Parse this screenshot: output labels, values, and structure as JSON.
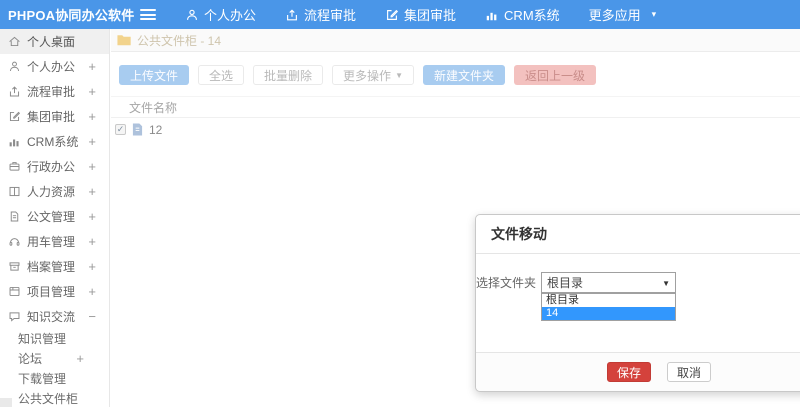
{
  "navbar": {
    "logo": "PHPOA协同办公软件",
    "items": [
      {
        "icon": "user-icon",
        "label": "个人办公"
      },
      {
        "icon": "upload-icon",
        "label": "流程审批"
      },
      {
        "icon": "edit-icon",
        "label": "集团审批"
      },
      {
        "icon": "chart-icon",
        "label": "CRM系统"
      },
      {
        "icon": "caret-down-icon",
        "label": "更多应用"
      }
    ],
    "caret": "▾"
  },
  "sidebar": {
    "items": [
      {
        "icon": "home-icon",
        "label": "个人桌面",
        "expand": "",
        "active": true
      },
      {
        "icon": "user-icon",
        "label": "个人办公",
        "expand": "+"
      },
      {
        "icon": "upload-icon",
        "label": "流程审批",
        "expand": "+"
      },
      {
        "icon": "edit-icon",
        "label": "集团审批",
        "expand": "+"
      },
      {
        "icon": "chart-icon",
        "label": "CRM系统",
        "expand": "+"
      },
      {
        "icon": "briefcase-icon",
        "label": "行政办公",
        "expand": "+"
      },
      {
        "icon": "book-icon",
        "label": "人力资源",
        "expand": "+"
      },
      {
        "icon": "document-icon",
        "label": "公文管理",
        "expand": "+"
      },
      {
        "icon": "headset-icon",
        "label": "用车管理",
        "expand": "+"
      },
      {
        "icon": "archive-icon",
        "label": "档案管理",
        "expand": "+"
      },
      {
        "icon": "project-icon",
        "label": "项目管理",
        "expand": "+"
      },
      {
        "icon": "chat-icon",
        "label": "知识交流",
        "expand": "−"
      }
    ],
    "subitems": [
      {
        "label": "知识管理",
        "expand": ""
      },
      {
        "label": "论坛",
        "expand": "+"
      },
      {
        "label": "下载管理",
        "expand": ""
      },
      {
        "label": "公共文件柜",
        "expand": ""
      }
    ]
  },
  "breadcrumb": {
    "icon": "folder-icon",
    "text": "公共文件柜 - 14"
  },
  "toolbar": {
    "upload_label": "上传文件",
    "select_all_label": "全选",
    "batch_delete_label": "批量删除",
    "more_actions_label": "更多操作",
    "more_actions_caret": "▼",
    "new_folder_label": "新建文件夹",
    "go_back_label": "返回上一级"
  },
  "table": {
    "header": "文件名称",
    "rows": [
      {
        "name": "12",
        "checked": true
      }
    ],
    "check_glyph": "✓"
  },
  "modal": {
    "title": "文件移动",
    "field_label": "选择文件夹",
    "select_value": "根目录",
    "select_caret": "▼",
    "options": [
      {
        "label": "根目录",
        "selected": false
      },
      {
        "label": "14",
        "selected": true
      }
    ],
    "save_label": "保存",
    "cancel_label": "取消"
  },
  "colors": {
    "navbar_blue": "#4a96e8",
    "option_highlight_blue": "#3297fd",
    "save_red": "#d4423c",
    "muted_blue_button": "#a8ccf0",
    "muted_red_button": "#f3c1bf",
    "folder_yellow": "#f2d38c"
  }
}
